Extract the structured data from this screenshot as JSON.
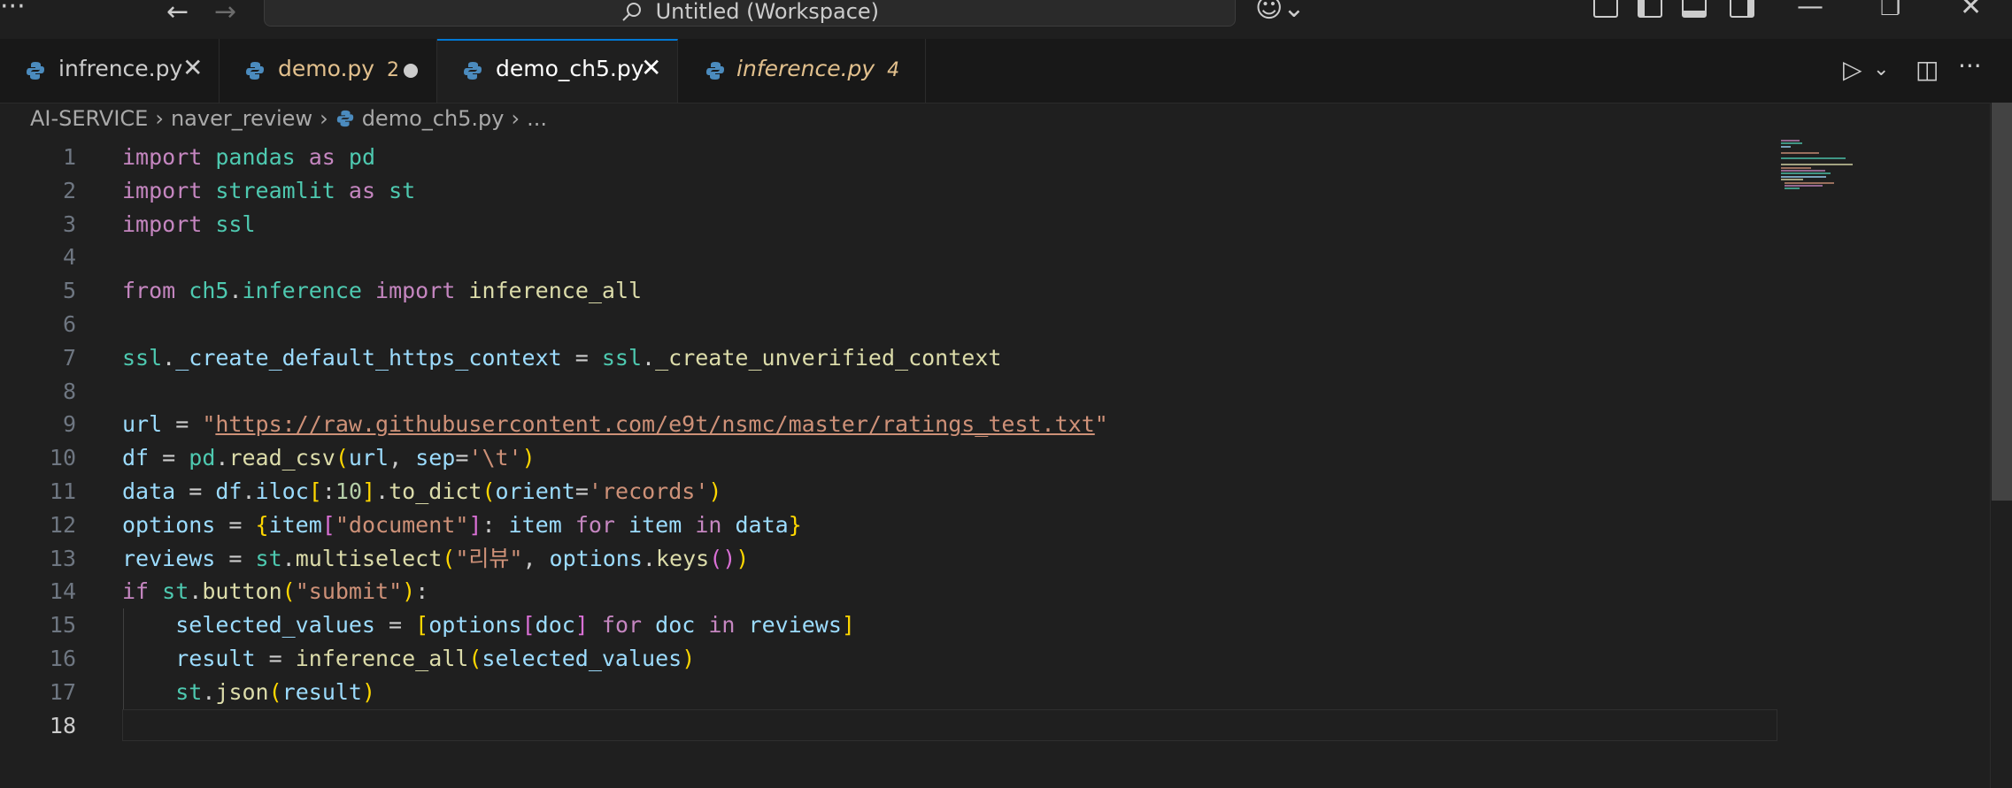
{
  "titlebar": {
    "search_text": "Untitled (Workspace)"
  },
  "tabs": [
    {
      "label": "infrence.py",
      "color": "#cccccc",
      "state": "close"
    },
    {
      "label": "demo.py",
      "badge": "2",
      "color": "#e2c08d",
      "state": "modified"
    },
    {
      "label": "demo_ch5.py",
      "color": "#ffffff",
      "state": "active"
    },
    {
      "label": "inference.py",
      "badge": "4",
      "color": "#e2c08d",
      "state": "preview"
    }
  ],
  "breadcrumb": {
    "root": "AI-SERVICE",
    "folder": "naver_review",
    "file": "demo_ch5.py",
    "more": "..."
  },
  "code": [
    {
      "n": "1",
      "t": "<span class='kw'>import</span> <span class='mod'>pandas</span> <span class='kw'>as</span> <span class='mod'>pd</span>"
    },
    {
      "n": "2",
      "t": "<span class='kw'>import</span> <span class='mod'>streamlit</span> <span class='kw'>as</span> <span class='mod'>st</span>"
    },
    {
      "n": "3",
      "t": "<span class='kw'>import</span> <span class='mod'>ssl</span>"
    },
    {
      "n": "4",
      "t": ""
    },
    {
      "n": "5",
      "t": "<span class='kw'>from</span> <span class='mod'>ch5</span>.<span class='mod'>inference</span> <span class='kw'>import</span> <span class='fn'>inference_all</span>"
    },
    {
      "n": "6",
      "t": ""
    },
    {
      "n": "7",
      "t": "<span class='mod'>ssl</span>.<span class='var'>_create_default_https_context</span> = <span class='mod'>ssl</span>.<span class='fn'>_create_unverified_context</span>"
    },
    {
      "n": "8",
      "t": ""
    },
    {
      "n": "9",
      "t": "<span class='var'>url</span> = <span class='str'>\"<span class='url'>https://raw.githubusercontent.com/e9t/nsmc/master/ratings_test.txt</span>\"</span>"
    },
    {
      "n": "10",
      "t": "<span class='var'>df</span> = <span class='mod'>pd</span>.<span class='fn'>read_csv</span><span class='p1'>(</span><span class='var'>url</span>, <span class='var'>sep</span>=<span class='str'>'\\t'</span><span class='p1'>)</span>"
    },
    {
      "n": "11",
      "t": "<span class='var'>data</span> = <span class='var'>df</span>.<span class='var'>iloc</span><span class='p1'>[</span>:<span class='num'>10</span><span class='p1'>]</span>.<span class='fn'>to_dict</span><span class='p1'>(</span><span class='var'>orient</span>=<span class='str'>'records'</span><span class='p1'>)</span>"
    },
    {
      "n": "12",
      "t": "<span class='var'>options</span> = <span class='p1'>{</span><span class='var'>item</span><span class='p2'>[</span><span class='str'>\"document\"</span><span class='p2'>]</span>: <span class='var'>item</span> <span class='kw'>for</span> <span class='var'>item</span> <span class='kw'>in</span> <span class='var'>data</span><span class='p1'>}</span>"
    },
    {
      "n": "13",
      "t": "<span class='var'>reviews</span> = <span class='mod'>st</span>.<span class='fn'>multiselect</span><span class='p1'>(</span><span class='str'>\"리뷰\"</span>, <span class='var'>options</span>.<span class='fn'>keys</span><span class='p2'>()</span><span class='p1'>)</span>"
    },
    {
      "n": "14",
      "t": "<span class='kw'>if</span> <span class='mod'>st</span>.<span class='fn'>button</span><span class='p1'>(</span><span class='str'>\"submit\"</span><span class='p1'>)</span>:"
    },
    {
      "n": "15",
      "t": "    <span class='var'>selected_values</span> = <span class='p1'>[</span><span class='var'>options</span><span class='p2'>[</span><span class='var'>doc</span><span class='p2'>]</span> <span class='kw'>for</span> <span class='var'>doc</span> <span class='kw'>in</span> <span class='var'>reviews</span><span class='p1'>]</span>"
    },
    {
      "n": "16",
      "t": "    <span class='var'>result</span> = <span class='fn'>inference_all</span><span class='p1'>(</span><span class='var'>selected_values</span><span class='p1'>)</span>"
    },
    {
      "n": "17",
      "t": "    <span class='mod'>st</span>.<span class='fn'>json</span><span class='p1'>(</span><span class='var'>result</span><span class='p1'>)</span>"
    },
    {
      "n": "18",
      "t": ""
    }
  ],
  "current_line": "18",
  "colors": {
    "background": "#1f1f1f",
    "tab_active_border": "#0078d4",
    "modified_tab": "#e2c08d"
  }
}
